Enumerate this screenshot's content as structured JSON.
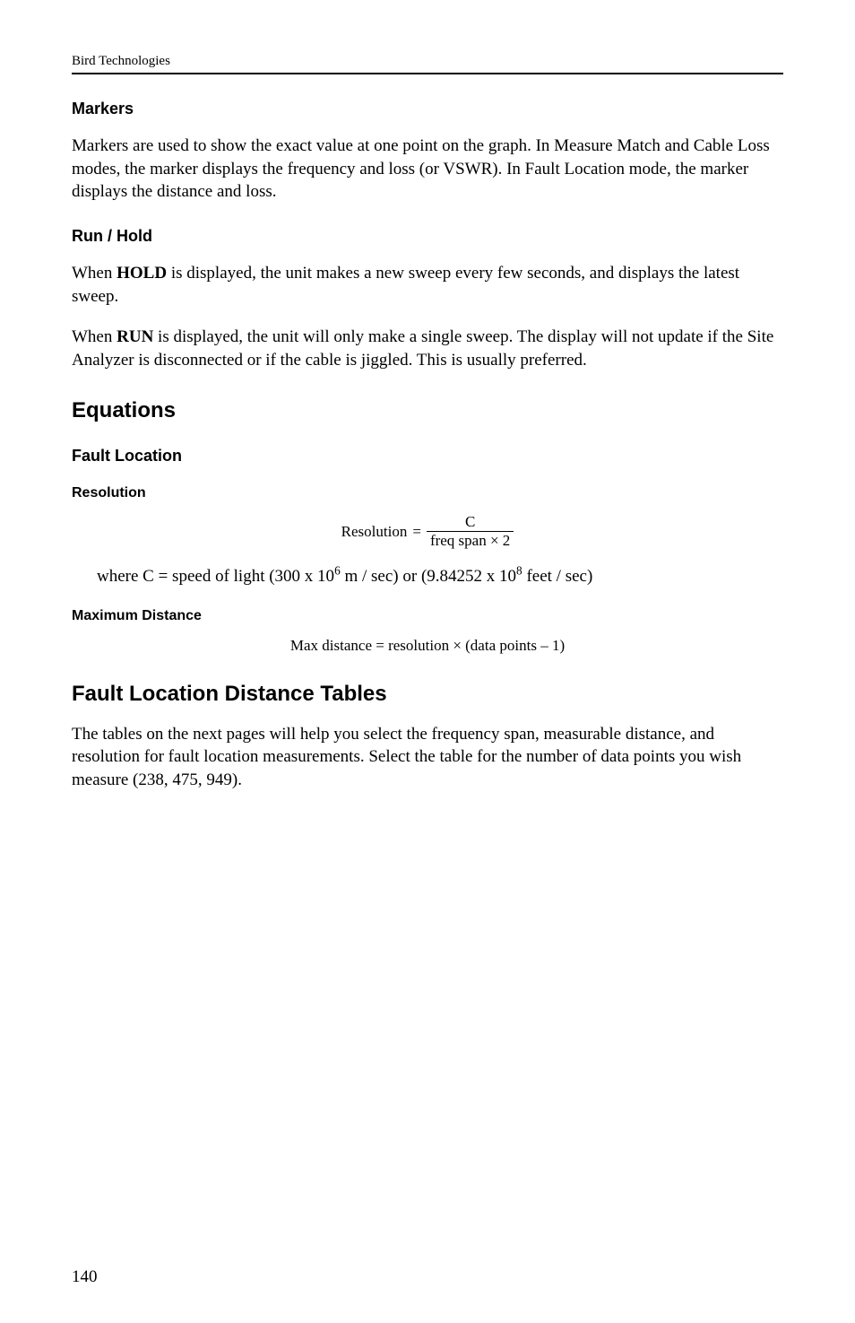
{
  "header": {
    "company": "Bird Technologies"
  },
  "markers": {
    "heading": "Markers",
    "para": "Markers are used to show the exact value at one point on the graph. In Measure Match and Cable Loss modes, the marker displays the frequency and loss (or VSWR). In Fault Location mode, the marker displays the distance and loss."
  },
  "runhold": {
    "heading": "Run / Hold",
    "p1_a": "When ",
    "p1_bold": "HOLD",
    "p1_b": " is displayed, the unit makes a new sweep every few seconds, and displays the latest sweep.",
    "p2_a": "When ",
    "p2_bold": "RUN",
    "p2_b": " is displayed, the unit will only make a single sweep. The display will not update if the Site Analyzer is disconnected or if the cable is jiggled. This is usually preferred."
  },
  "equations": {
    "heading": "Equations",
    "fault_loc_heading": "Fault Location",
    "resolution_heading": "Resolution",
    "resolution_eq": {
      "lhs": "Resolution",
      "eq": " = ",
      "num": "C",
      "den": "freq span × 2"
    },
    "speed_a": "where C = speed of light (300 x 10",
    "speed_sup1": "6",
    "speed_b": " m / sec) or (9.84252 x 10",
    "speed_sup2": "8",
    "speed_c": " feet / sec)",
    "maxdist_heading": "Maximum Distance",
    "maxdist_eq": "Max distance  =  resolution × (data points – 1)"
  },
  "tables": {
    "heading": "Fault Location Distance Tables",
    "para": "The tables on the next pages will help you select the frequency span, measurable distance, and resolution for fault location measurements. Select the table for the number of data points you wish measure (238, 475, 949)."
  },
  "pagenum": "140"
}
